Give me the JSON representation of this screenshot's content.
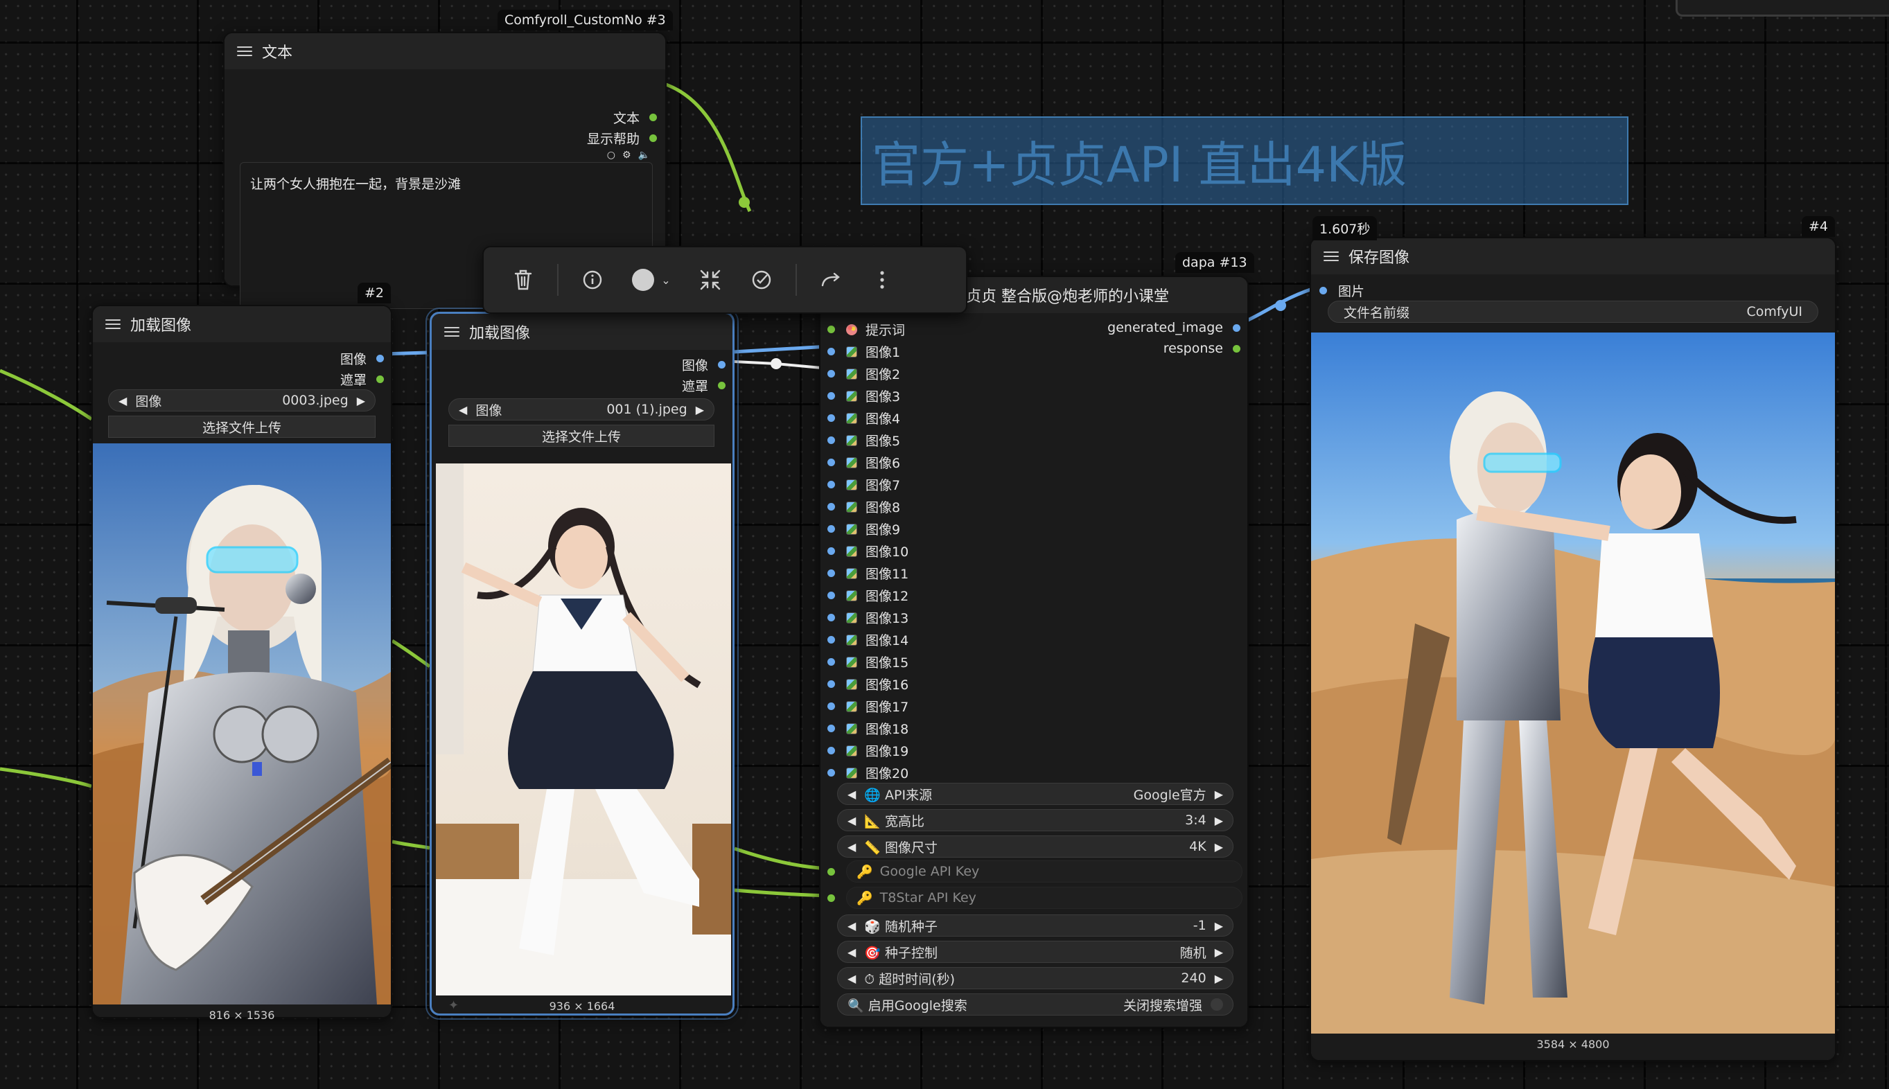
{
  "canvas": {
    "top_right_panel": ""
  },
  "note": {
    "text": "官方+贞贞API 直出4K版"
  },
  "text_node": {
    "badge": "Comfyroll_CustomNo #3",
    "title": "文本",
    "outputs": [
      "文本",
      "显示帮助"
    ],
    "text_value": "让两个女人拥抱在一起，背景是沙滩"
  },
  "load_image_a": {
    "badge": "#2",
    "title": "加载图像",
    "outputs": [
      "图像",
      "遮罩"
    ],
    "image_widget_label": "图像",
    "image_widget_value": "0003.jpeg",
    "upload_label": "选择文件上传",
    "dimensions": "816 × 1536"
  },
  "load_image_b": {
    "title": "加载图像",
    "outputs": [
      "图像",
      "遮罩"
    ],
    "image_widget_label": "图像",
    "image_widget_value": "001 (1).jpeg",
    "upload_label": "选择文件上传",
    "dimensions": "936 × 1664"
  },
  "toolbar": {
    "delete_icon": "trash-icon",
    "info_icon": "info-icon",
    "color_icon": "color-circle-icon",
    "collapse_icon": "collapse-icon",
    "bypass_icon": "bypass-icon",
    "redo_icon": "redo-icon",
    "more_icon": "more-vertical-icon"
  },
  "dapa_node": {
    "badge": "dapa #13",
    "title": "贞贞 整合版@炮老师的小课堂",
    "inputs": [
      "提示词",
      "图像1",
      "图像2",
      "图像3",
      "图像4",
      "图像5",
      "图像6",
      "图像7",
      "图像8",
      "图像9",
      "图像10",
      "图像11",
      "图像12",
      "图像13",
      "图像14",
      "图像15",
      "图像16",
      "图像17",
      "图像18",
      "图像19",
      "图像20"
    ],
    "outputs": [
      "generated_image",
      "response"
    ],
    "widgets": [
      {
        "label": "API来源",
        "value": "Google官方"
      },
      {
        "label": "宽高比",
        "value": "3:4"
      },
      {
        "label": "图像尺寸",
        "value": "4K"
      },
      {
        "label": "Google API Key",
        "value": ""
      },
      {
        "label": "T8Star API Key",
        "value": ""
      },
      {
        "label": "随机种子",
        "value": "-1"
      },
      {
        "label": "种子控制",
        "value": "随机"
      },
      {
        "label": "超时时间(秒)",
        "value": "240"
      },
      {
        "label": "启用Google搜索",
        "value": "关闭搜索增强"
      }
    ]
  },
  "save_node": {
    "time_badge": "1.607秒",
    "badge": "#4",
    "title": "保存图像",
    "input": "图片",
    "prefix_label": "文件名前缀",
    "prefix_value": "ComfyUI",
    "dimensions": "3584 × 4800"
  },
  "colors": {
    "image_link": "#6aa9ef",
    "mask_link": "#77c33d",
    "string_link": "#77c33d",
    "selection": "#4a7fc0",
    "note": "#2e68a0"
  }
}
